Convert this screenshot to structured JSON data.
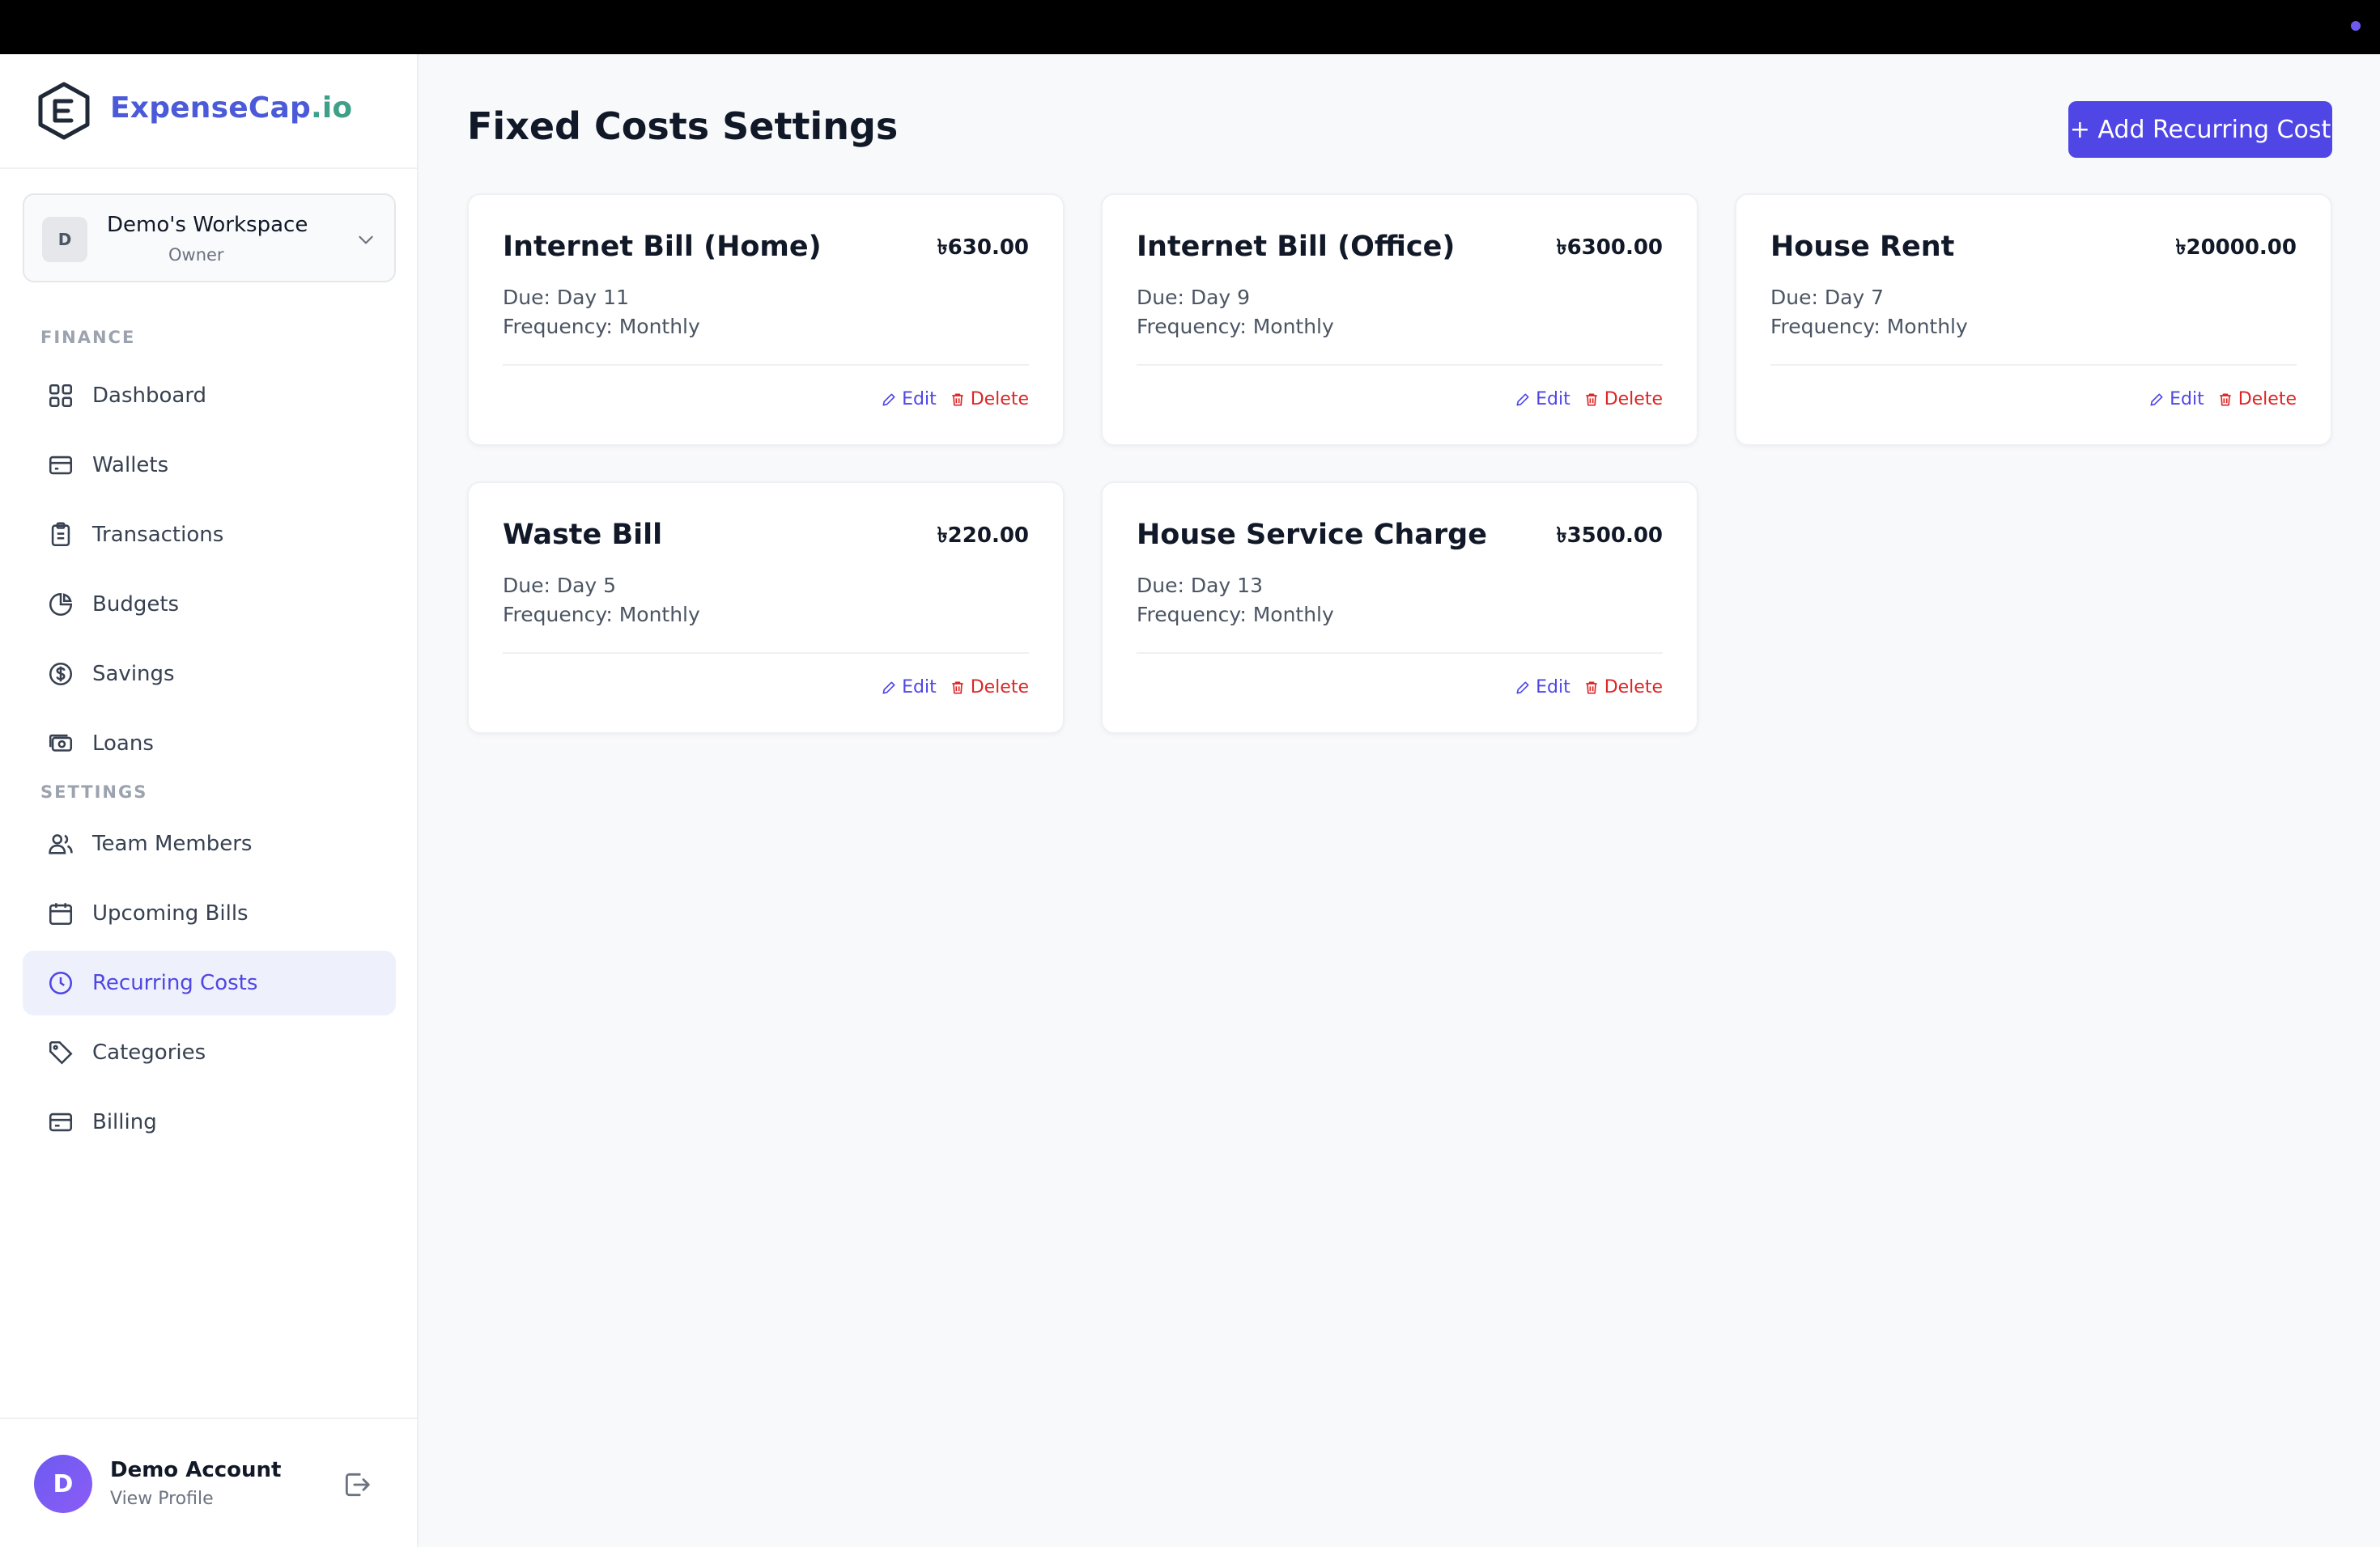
{
  "brand": {
    "name_main": "ExpenseCap",
    "name_suffix": ".io"
  },
  "workspace": {
    "initial": "D",
    "name": "Demo's Workspace",
    "role": "Owner"
  },
  "sidebar": {
    "finance_label": "FINANCE",
    "settings_label": "SETTINGS",
    "finance_items": [
      {
        "label": "Dashboard",
        "icon": "dashboard-icon"
      },
      {
        "label": "Wallets",
        "icon": "wallet-icon"
      },
      {
        "label": "Transactions",
        "icon": "clipboard-icon"
      },
      {
        "label": "Budgets",
        "icon": "pie-chart-icon"
      },
      {
        "label": "Savings",
        "icon": "dollar-circle-icon"
      },
      {
        "label": "Loans",
        "icon": "cash-icon"
      }
    ],
    "settings_items": [
      {
        "label": "Team Members",
        "icon": "users-icon"
      },
      {
        "label": "Upcoming Bills",
        "icon": "calendar-icon"
      },
      {
        "label": "Recurring Costs",
        "icon": "clock-icon",
        "active": true
      },
      {
        "label": "Categories",
        "icon": "tag-icon"
      },
      {
        "label": "Billing",
        "icon": "credit-card-icon"
      }
    ]
  },
  "profile": {
    "initial": "D",
    "name": "Demo Account",
    "link": "View Profile"
  },
  "main": {
    "title": "Fixed Costs Settings",
    "add_button": "+ Add Recurring Cost",
    "edit_label": "Edit",
    "delete_label": "Delete",
    "cards": [
      {
        "title": "Internet Bill (Home)",
        "amount": "৳630.00",
        "due": "Due: Day 11",
        "frequency": "Frequency: Monthly"
      },
      {
        "title": "Internet Bill (Office)",
        "amount": "৳6300.00",
        "due": "Due: Day 9",
        "frequency": "Frequency: Monthly"
      },
      {
        "title": "House Rent",
        "amount": "৳20000.00",
        "due": "Due: Day 7",
        "frequency": "Frequency: Monthly"
      },
      {
        "title": "Waste Bill",
        "amount": "৳220.00",
        "due": "Due: Day 5",
        "frequency": "Frequency: Monthly"
      },
      {
        "title": "House Service Charge",
        "amount": "৳3500.00",
        "due": "Due: Day 13",
        "frequency": "Frequency: Monthly"
      }
    ]
  },
  "colors": {
    "accent": "#4f46e5",
    "brand_blue": "#4b5ad8",
    "brand_green": "#3fa08a",
    "danger": "#dc2626",
    "active_bg": "#eef0fb"
  }
}
